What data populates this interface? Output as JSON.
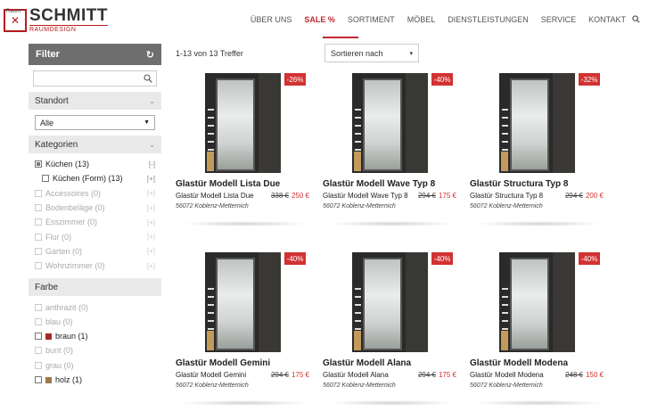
{
  "brand": {
    "small": "Raum",
    "name": "SCHMITT",
    "sub": "RAUMDESIGN",
    "color": "#b71c1c"
  },
  "nav": [
    {
      "label": "ÜBER UNS",
      "active": false
    },
    {
      "label": "SALE %",
      "active": true
    },
    {
      "label": "SORTIMENT",
      "active": false
    },
    {
      "label": "MÖBEL",
      "active": false
    },
    {
      "label": "DIENSTLEISTUNGEN",
      "active": false
    },
    {
      "label": "SERVICE",
      "active": false
    },
    {
      "label": "KONTAKT",
      "active": false
    }
  ],
  "sidebar": {
    "filter_title": "Filter",
    "standort_title": "Standort",
    "standort_value": "Alle",
    "kategorien_title": "Kategorien",
    "kategorien": [
      {
        "label": "Küchen (13)",
        "toggle": "[-]",
        "checked": true,
        "disabled": false,
        "indent": false
      },
      {
        "label": "Küchen (Form) (13)",
        "toggle": "[+]",
        "checked": false,
        "disabled": false,
        "indent": true
      },
      {
        "label": "Accessoires (0)",
        "toggle": "[+]",
        "checked": false,
        "disabled": true,
        "indent": false
      },
      {
        "label": "Bodenbeläge (0)",
        "toggle": "[+]",
        "checked": false,
        "disabled": true,
        "indent": false
      },
      {
        "label": "Esszimmer (0)",
        "toggle": "[+]",
        "checked": false,
        "disabled": true,
        "indent": false
      },
      {
        "label": "Flur (0)",
        "toggle": "[+]",
        "checked": false,
        "disabled": true,
        "indent": false
      },
      {
        "label": "Garten (0)",
        "toggle": "[+]",
        "checked": false,
        "disabled": true,
        "indent": false
      },
      {
        "label": "Wohnzimmer (0)",
        "toggle": "[+]",
        "checked": false,
        "disabled": true,
        "indent": false
      }
    ],
    "farbe_title": "Farbe",
    "farben": [
      {
        "label": "anthrazit (0)",
        "disabled": true,
        "swatch": ""
      },
      {
        "label": "blau (0)",
        "disabled": true,
        "swatch": ""
      },
      {
        "label": "braun (1)",
        "disabled": false,
        "swatch": "#a52a2a"
      },
      {
        "label": "bunt (0)",
        "disabled": true,
        "swatch": ""
      },
      {
        "label": "grau (0)",
        "disabled": true,
        "swatch": ""
      },
      {
        "label": "holz (1)",
        "disabled": false,
        "swatch": "#9c7a4a"
      }
    ]
  },
  "main": {
    "result_count": "1-13 von 13 Treffer",
    "sort_label": "Sortieren nach",
    "products": [
      {
        "title": "Glastür Modell Lista Due",
        "subtitle": "Glastür Modell Lista Due",
        "old_price": "338 €",
        "new_price": "250 €",
        "discount": "-26%",
        "location": "56072 Koblenz-Metternich"
      },
      {
        "title": "Glastür Modell Wave Typ 8",
        "subtitle": "Glastür Modell Wave Typ 8",
        "old_price": "294 €",
        "new_price": "175 €",
        "discount": "-40%",
        "location": "56072 Koblenz-Metternich"
      },
      {
        "title": "Glastür Structura Typ 8",
        "subtitle": "Glastür Structura Typ 8",
        "old_price": "294 €",
        "new_price": "200 €",
        "discount": "-32%",
        "location": "56072 Koblenz-Metternich"
      },
      {
        "title": "Glastür Modell Gemini",
        "subtitle": "Glastür Modell Gemini",
        "old_price": "294 €",
        "new_price": "175 €",
        "discount": "-40%",
        "location": "56072 Koblenz-Metternich"
      },
      {
        "title": "Glastür Modell Alana",
        "subtitle": "Glastür Modell Alana",
        "old_price": "294 €",
        "new_price": "175 €",
        "discount": "-40%",
        "location": "56072 Koblenz-Metternich"
      },
      {
        "title": "Glastür Modell Modena",
        "subtitle": "Glastür Modell Modena",
        "old_price": "248 €",
        "new_price": "150 €",
        "discount": "-40%",
        "location": "56072 Koblenz-Metternich"
      }
    ]
  }
}
